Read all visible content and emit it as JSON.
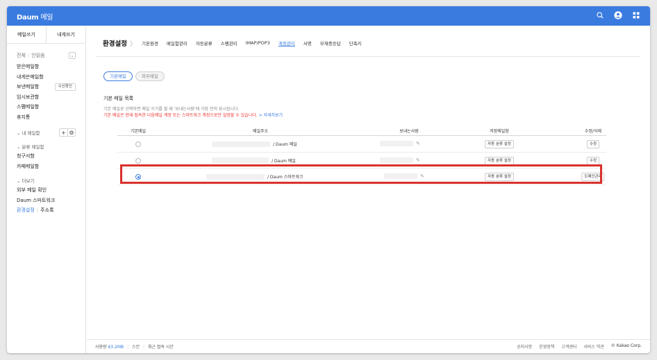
{
  "app": {
    "logo": "Daum",
    "service": "메일"
  },
  "sidebar": {
    "write_label": "메일쓰기",
    "self_write_label": "내게쓰기",
    "filter_all": "전체",
    "filter_unread": "안읽음",
    "mailboxes": [
      {
        "label": "받은메일함"
      },
      {
        "label": "내게쓴메일함"
      },
      {
        "label": "보낸메일함",
        "action": "수신확인"
      },
      {
        "label": "임시보관함"
      },
      {
        "label": "스팸메일함"
      },
      {
        "label": "휴지통"
      }
    ],
    "my_mailbox_label": "내 메일함",
    "category_group_label": "분류 메일함",
    "category_items": [
      "청구서함",
      "카페메일함"
    ],
    "more_group_label": "더보기",
    "more_items": [
      "외부 메일 확인",
      "Daum 스마트워크"
    ],
    "settings_link": "환경설정",
    "address_book_link": "주소록"
  },
  "main": {
    "title": "환경설정",
    "tabs": [
      {
        "label": "기본환경",
        "active": false
      },
      {
        "label": "메일함관리",
        "active": false
      },
      {
        "label": "자동분류",
        "active": false
      },
      {
        "label": "스팸관리",
        "active": false
      },
      {
        "label": "IMAP/POP3",
        "active": false
      },
      {
        "label": "계정관리",
        "active": true
      },
      {
        "label": "서명",
        "active": false
      },
      {
        "label": "부재중응답",
        "active": false
      },
      {
        "label": "단축키",
        "active": false
      }
    ],
    "subtabs": [
      {
        "label": "기본메일",
        "active": true
      },
      {
        "label": "외부메일",
        "active": false
      }
    ],
    "section_title": "기본 메일 목록",
    "desc1": "기본 메일로 선택하면 메일 쓰기를 할 때 '보내는사람'에 가장 먼저 표시됩니다.",
    "desc2": "기본 메일은 현재 접속한 다음메일 계정 또는 스마트워크 계정으로만 설정할 수 있습니다.",
    "desc2_more": "> 자세히보기",
    "table": {
      "headers": [
        "기본메일",
        "메일주소",
        "보내는사람",
        "저장메일함",
        "수정/삭제"
      ],
      "rows": [
        {
          "selected": false,
          "address_suffix": "/ Daum 메일",
          "folder_button": "자동 분류 설정",
          "action_button": "수정"
        },
        {
          "selected": false,
          "address_suffix": "/ Daum 메일",
          "folder_button": "자동 분류 설정",
          "action_button": "수정"
        },
        {
          "selected": true,
          "address_suffix": "/ Daum 스마트워크",
          "folder_button": "자동 분류 설정",
          "action_button": "도메인관리"
        }
      ]
    }
  },
  "footer": {
    "usage_label": "사용량",
    "usage_value": "63.2MB",
    "skin_label": "스킨",
    "recent_login_label": "최근 접속 시간",
    "links": [
      "공지사항",
      "운영정책",
      "고객센터",
      "서비스 약관"
    ],
    "copyright": "© Kakao Corp."
  },
  "colors": {
    "brand": "#3a7be0",
    "highlight": "#d9302a",
    "warning": "#e33333"
  },
  "icons": [
    "search-icon",
    "profile-icon",
    "apps-grid-icon",
    "chevron-right-icon",
    "pencil-icon",
    "chevron-down-icon",
    "plus-icon",
    "gear-icon"
  ]
}
